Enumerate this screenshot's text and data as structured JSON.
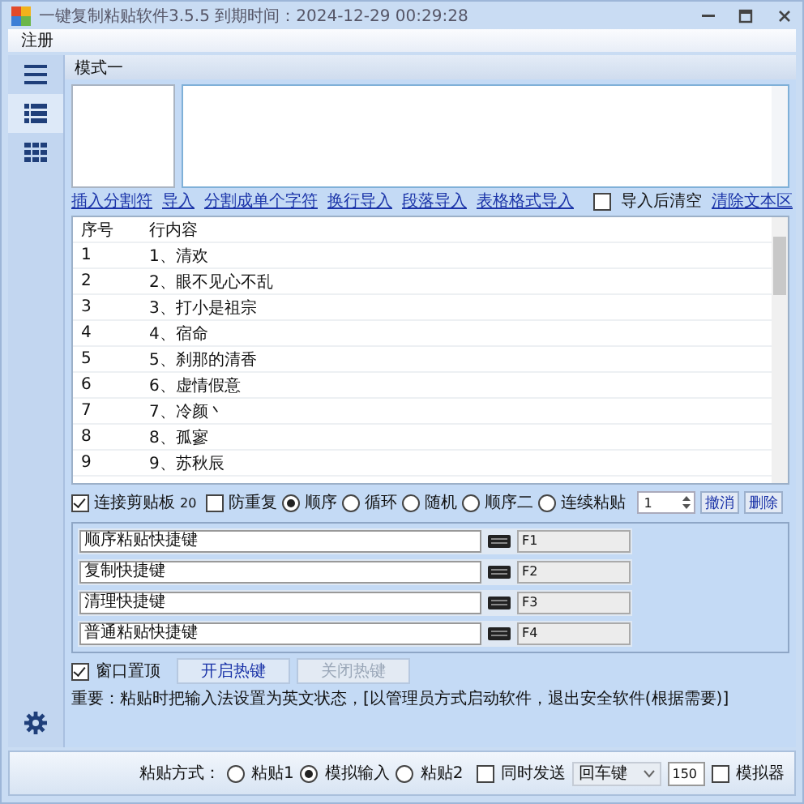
{
  "window": {
    "title": "一键复制粘贴软件3.5.5 到期时间：2024-12-29 00:29:28"
  },
  "menu": [
    "注册"
  ],
  "sidebar": {
    "items": [
      {
        "kind": "menu",
        "selected": false
      },
      {
        "kind": "list",
        "selected": true
      },
      {
        "kind": "grid",
        "selected": false
      }
    ]
  },
  "mode_title": "模式一",
  "links": [
    "插入分割符",
    "导入",
    "分割成单个字符",
    "换行导入",
    "段落导入",
    "表格格式导入"
  ],
  "clear_after_import": {
    "label": "导入后清空",
    "checked": false
  },
  "clear_link": "清除文本区",
  "table": {
    "columns": [
      "序号",
      "行内容"
    ],
    "rows": [
      [
        "1",
        "1、清欢"
      ],
      [
        "2",
        "2、眼不见心不乱"
      ],
      [
        "3",
        "3、打小是祖宗"
      ],
      [
        "4",
        "4、宿命"
      ],
      [
        "5",
        "5、刹那的清香"
      ],
      [
        "6",
        "6、虚情假意"
      ],
      [
        "7",
        "7、冷颜丶"
      ],
      [
        "8",
        "8、孤寥"
      ],
      [
        "9",
        "9、苏秋辰"
      ]
    ]
  },
  "options": {
    "clipboard": {
      "label": "连接剪贴板",
      "checked": true
    },
    "count": "20",
    "dedupe": {
      "label": "防重复",
      "checked": false
    },
    "modes": [
      {
        "label": "顺序",
        "selected": true
      },
      {
        "label": "循环",
        "selected": false
      },
      {
        "label": "随机",
        "selected": false
      },
      {
        "label": "顺序二",
        "selected": false
      },
      {
        "label": "连续粘贴",
        "selected": false
      }
    ],
    "spinner": "1",
    "buttons": [
      "撤消",
      "删除"
    ]
  },
  "hotkeys": [
    {
      "label": "顺序粘贴快捷键",
      "key": "F1"
    },
    {
      "label": "复制快捷键",
      "key": "F2"
    },
    {
      "label": "清理快捷键",
      "key": "F3"
    },
    {
      "label": "普通粘贴快捷键",
      "key": "F4"
    }
  ],
  "topmost": {
    "label": "窗口置顶",
    "checked": true
  },
  "hotkey_buttons": [
    {
      "label": "开启热键",
      "disabled": false
    },
    {
      "label": "关闭热键",
      "disabled": true
    }
  ],
  "note": "重要：粘贴时把输入法设置为英文状态，[以管理员方式启动软件，退出安全软件(根据需要)]",
  "bottom": {
    "label": "粘贴方式：",
    "modes": [
      {
        "label": "粘贴1",
        "selected": false
      },
      {
        "label": "模拟输入",
        "selected": true
      },
      {
        "label": "粘贴2",
        "selected": false
      }
    ],
    "send": {
      "label": "同时发送",
      "checked": false
    },
    "key": "回车键",
    "delay": "150",
    "emulator": {
      "label": "模拟器",
      "checked": false
    }
  }
}
